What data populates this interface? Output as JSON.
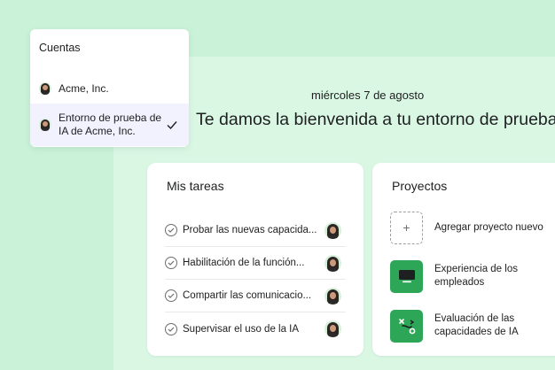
{
  "accounts_menu": {
    "title": "Cuentas",
    "items": [
      {
        "label": "Acme, Inc."
      },
      {
        "label": "Entorno de prueba de IA de Acme, Inc.",
        "selected": true
      }
    ]
  },
  "header": {
    "date": "miércoles 7 de agosto",
    "welcome": "Te damos la bienvenida a tu entorno de prueba"
  },
  "tasks_card": {
    "title": "Mis tareas",
    "items": [
      {
        "label": "Probar las nuevas capacida..."
      },
      {
        "label": "Habilitación de la función..."
      },
      {
        "label": "Compartir las comunicacio..."
      },
      {
        "label": "Supervisar el uso de la IA"
      }
    ]
  },
  "projects_card": {
    "title": "Proyectos",
    "items": [
      {
        "label": "Agregar proyecto nuevo",
        "icon": "plus-icon"
      },
      {
        "label": "Experiencia de los empleados",
        "icon": "monitor-icon"
      },
      {
        "label": "Evaluación de las capacidades de IA",
        "icon": "path-icon"
      }
    ]
  },
  "colors": {
    "background": "#c9f2d8",
    "main_area": "#daf7e4",
    "project_green": "#2da657",
    "selected_item": "#f1f2fd"
  }
}
